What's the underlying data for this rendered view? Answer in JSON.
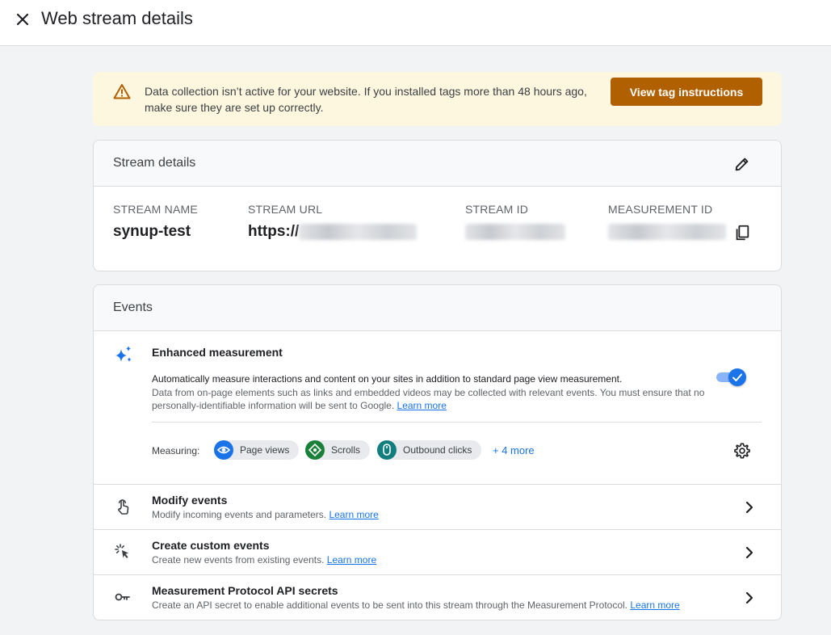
{
  "header": {
    "title": "Web stream details",
    "close_icon": "close-icon"
  },
  "banner": {
    "icon": "warning-icon",
    "message": "Data collection isn’t active for your website. If you installed tags more than 48 hours ago, make sure they are set up correctly.",
    "button_label": "View tag instructions",
    "button_color": "#b06000",
    "background": "#fef7e0"
  },
  "stream_details": {
    "title": "Stream details",
    "edit_icon": "pencil-icon",
    "columns": [
      {
        "label": "STREAM NAME",
        "value": "synup-test"
      },
      {
        "label": "STREAM URL",
        "value": "https://"
      },
      {
        "label": "STREAM ID",
        "value": ""
      },
      {
        "label": "MEASUREMENT ID",
        "value": ""
      }
    ],
    "copy_icon": "copy-icon"
  },
  "events": {
    "title": "Events",
    "enhanced": {
      "icon": "sparkle-icon",
      "title": "Enhanced measurement",
      "description_main": "Automatically measure interactions and content on your sites in addition to standard page view measurement.",
      "description_sub": "Data from on-page elements such as links and embedded videos may be collected with relevant events. You must ensure that no personally-identifiable information will be sent to Google.",
      "learn_more": "Learn more",
      "toggle_on": true,
      "measuring_label": "Measuring:",
      "chips": [
        {
          "label": "Page views",
          "icon": "eye-icon",
          "color": "#1a73e8"
        },
        {
          "label": "Scrolls",
          "icon": "scroll-icon",
          "color": "#188038"
        },
        {
          "label": "Outbound clicks",
          "icon": "mouse-icon",
          "color": "#137e7e"
        }
      ],
      "more_label": "+ 4 more",
      "settings_icon": "gear-icon"
    },
    "rows": [
      {
        "icon": "touch-icon",
        "title": "Modify events",
        "description": "Modify incoming events and parameters.",
        "learn_more": "Learn more"
      },
      {
        "icon": "cursor-click-icon",
        "title": "Create custom events",
        "description": "Create new events from existing events.",
        "learn_more": "Learn more"
      },
      {
        "icon": "key-icon",
        "title": "Measurement Protocol API secrets",
        "description": "Create an API secret to enable additional events to be sent into this stream through the Measurement Protocol.",
        "learn_more": "Learn more"
      }
    ]
  },
  "colors": {
    "accent": "#1a73e8",
    "background": "#f1f3f4"
  }
}
